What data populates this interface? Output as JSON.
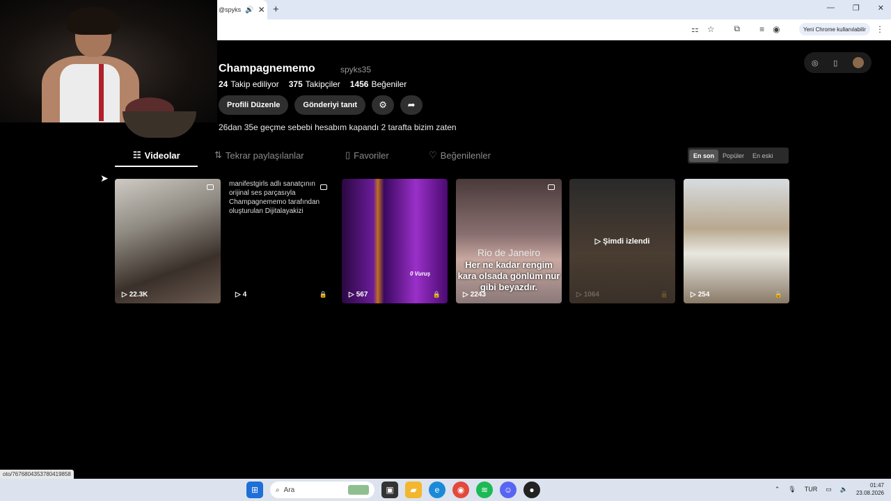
{
  "browser": {
    "tab_title": "@spyks",
    "tab_audio_icon": "speaker-icon",
    "new_tab": "+",
    "chrome_pill": "Yeni Chrome kullanılabilir"
  },
  "profile": {
    "name": "Champagnememo",
    "handle": "spyks35",
    "stats": [
      {
        "value": "24",
        "label": "Takip ediliyor"
      },
      {
        "value": "375",
        "label": "Takipçiler"
      },
      {
        "value": "1456",
        "label": "Beğeniler"
      }
    ],
    "edit_button": "Profili Düzenle",
    "promote_button": "Gönderiyi tanıt",
    "bio": "26dan 35e geçme sebebi hesabım kapandı 2 tarafta bizim zaten"
  },
  "tabs": [
    {
      "label": "Videolar",
      "icon": "grid-icon"
    },
    {
      "label": "Tekrar paylaşılanlar",
      "icon": "repost-icon"
    },
    {
      "label": "Favoriler",
      "icon": "bookmark-icon"
    },
    {
      "label": "Beğenilenler",
      "icon": "heart-icon"
    }
  ],
  "sort": [
    "En son",
    "Popüler",
    "En eski"
  ],
  "videos": [
    {
      "views": "22.3K"
    },
    {
      "views": "4",
      "alt": "manifestgirls adlı sanatçının orijinal ses parçasıyla Champagnememo tarafından oluşturulan Dijitalayakizi"
    },
    {
      "views": "567",
      "caption": "0 Vuruş"
    },
    {
      "views": "2243",
      "city": "Rio de Janeiro",
      "caption": "Her ne kadar rengim kara olsada gönlüm nur gibi beyazdır."
    },
    {
      "views": "1064",
      "watched": "Şimdi izlendi"
    },
    {
      "views": "254"
    }
  ],
  "status_url": "oto/7676804353780419858",
  "taskbar": {
    "search": "Ara",
    "lang": "TUR",
    "time": "01:47",
    "date": "23.08.2026"
  }
}
